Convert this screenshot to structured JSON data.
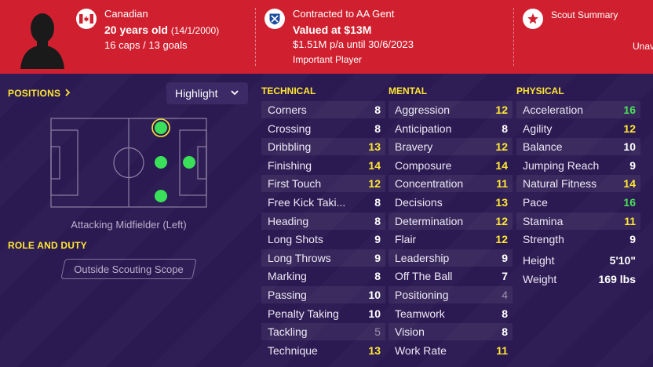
{
  "header": {
    "nationality": "Canadian",
    "age": "20 years old",
    "dob": "(14/1/2000)",
    "caps_goals": "16 caps / 13 goals",
    "contract": "Contracted to AA Gent",
    "value": "Valued at $13M",
    "wage": "$1.51M p/a until 30/6/2023",
    "status": "Important Player",
    "scout_title": "Scout Summary",
    "scout_clipped": "Unav"
  },
  "positions": {
    "title": "POSITIONS",
    "highlight_label": "Highlight",
    "position_label": "Attacking Midfielder (Left)"
  },
  "role": {
    "title": "ROLE AND DUTY",
    "scope_label": "Outside Scouting Scope"
  },
  "columns": {
    "technical": "TECHNICAL",
    "mental": "MENTAL",
    "physical": "PHYSICAL"
  },
  "technical": [
    {
      "name": "Corners",
      "value": "8",
      "tone": "white"
    },
    {
      "name": "Crossing",
      "value": "8",
      "tone": "white"
    },
    {
      "name": "Dribbling",
      "value": "13",
      "tone": "yellow"
    },
    {
      "name": "Finishing",
      "value": "14",
      "tone": "yellow"
    },
    {
      "name": "First Touch",
      "value": "12",
      "tone": "yellow"
    },
    {
      "name": "Free Kick Taki...",
      "value": "8",
      "tone": "white"
    },
    {
      "name": "Heading",
      "value": "8",
      "tone": "white"
    },
    {
      "name": "Long Shots",
      "value": "9",
      "tone": "white"
    },
    {
      "name": "Long Throws",
      "value": "9",
      "tone": "white"
    },
    {
      "name": "Marking",
      "value": "8",
      "tone": "white"
    },
    {
      "name": "Passing",
      "value": "10",
      "tone": "white"
    },
    {
      "name": "Penalty Taking",
      "value": "10",
      "tone": "white"
    },
    {
      "name": "Tackling",
      "value": "5",
      "tone": "grey"
    },
    {
      "name": "Technique",
      "value": "13",
      "tone": "yellow"
    }
  ],
  "mental": [
    {
      "name": "Aggression",
      "value": "12",
      "tone": "yellow"
    },
    {
      "name": "Anticipation",
      "value": "8",
      "tone": "white"
    },
    {
      "name": "Bravery",
      "value": "12",
      "tone": "yellow"
    },
    {
      "name": "Composure",
      "value": "14",
      "tone": "yellow"
    },
    {
      "name": "Concentration",
      "value": "11",
      "tone": "yellow"
    },
    {
      "name": "Decisions",
      "value": "13",
      "tone": "yellow"
    },
    {
      "name": "Determination",
      "value": "12",
      "tone": "yellow"
    },
    {
      "name": "Flair",
      "value": "12",
      "tone": "yellow"
    },
    {
      "name": "Leadership",
      "value": "9",
      "tone": "white"
    },
    {
      "name": "Off The Ball",
      "value": "7",
      "tone": "white"
    },
    {
      "name": "Positioning",
      "value": "4",
      "tone": "grey"
    },
    {
      "name": "Teamwork",
      "value": "8",
      "tone": "white"
    },
    {
      "name": "Vision",
      "value": "8",
      "tone": "white"
    },
    {
      "name": "Work Rate",
      "value": "11",
      "tone": "yellow"
    }
  ],
  "physical": [
    {
      "name": "Acceleration",
      "value": "16",
      "tone": "green"
    },
    {
      "name": "Agility",
      "value": "12",
      "tone": "yellow"
    },
    {
      "name": "Balance",
      "value": "10",
      "tone": "white"
    },
    {
      "name": "Jumping Reach",
      "value": "9",
      "tone": "white"
    },
    {
      "name": "Natural Fitness",
      "value": "14",
      "tone": "yellow"
    },
    {
      "name": "Pace",
      "value": "16",
      "tone": "green"
    },
    {
      "name": "Stamina",
      "value": "11",
      "tone": "yellow"
    },
    {
      "name": "Strength",
      "value": "9",
      "tone": "white"
    }
  ],
  "physical_info": [
    {
      "name": "Height",
      "value": "5'10\""
    },
    {
      "name": "Weight",
      "value": "169 lbs"
    }
  ],
  "colors": {
    "header_red": "#d0202f",
    "background": "#2b1a52",
    "accent_yellow": "#ffe733",
    "high_green": "#4ce05a"
  }
}
